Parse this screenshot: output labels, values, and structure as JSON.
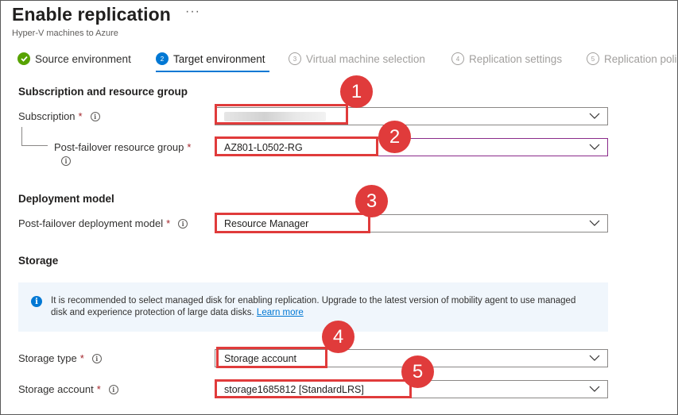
{
  "header": {
    "title": "Enable replication",
    "more_label": "···",
    "subtitle": "Hyper-V machines to Azure"
  },
  "steps": [
    {
      "number": "✓",
      "label": "Source environment",
      "state": "completed"
    },
    {
      "number": "2",
      "label": "Target environment",
      "state": "active"
    },
    {
      "number": "3",
      "label": "Virtual machine selection",
      "state": "pending"
    },
    {
      "number": "4",
      "label": "Replication settings",
      "state": "pending"
    },
    {
      "number": "5",
      "label": "Replication poli",
      "state": "pending"
    }
  ],
  "sections": {
    "subscription_group": "Subscription and resource group",
    "deployment_model": "Deployment model",
    "storage": "Storage"
  },
  "fields": {
    "subscription": {
      "label": "Subscription",
      "required": "*",
      "value": ""
    },
    "resource_group": {
      "label": "Post-failover resource group",
      "required": "*",
      "value": "AZ801-L0502-RG"
    },
    "deployment_model": {
      "label": "Post-failover deployment model",
      "required": "*",
      "value": "Resource Manager"
    },
    "storage_type": {
      "label": "Storage type",
      "required": "*",
      "value": "Storage account"
    },
    "storage_account": {
      "label": "Storage account",
      "required": "*",
      "value": "storage1685812 [StandardLRS]"
    }
  },
  "info_box": {
    "text": "It is recommended to select managed disk for enabling replication. Upgrade to the latest version of mobility agent to use managed disk and experience protection of large data disks.",
    "link": "Learn more"
  },
  "callouts": [
    "1",
    "2",
    "3",
    "4",
    "5"
  ],
  "colors": {
    "accent": "#0078d4",
    "success": "#57a300",
    "required": "#a4262c",
    "callout": "#e03b3b",
    "info_bg": "#f0f6fc"
  },
  "icons": [
    "check-icon",
    "info-icon",
    "chevron-down-icon",
    "more-icon"
  ]
}
